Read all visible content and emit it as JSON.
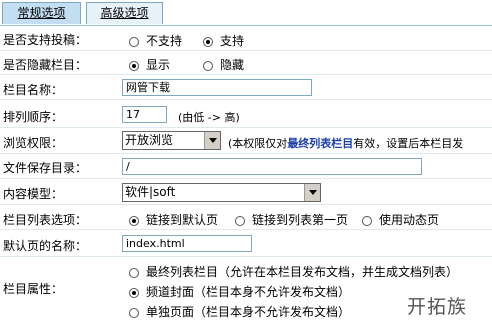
{
  "tabs": {
    "basic": "常规选项",
    "advanced": "高级选项"
  },
  "fields": {
    "allow_submit": {
      "label": "是否支持投稿：",
      "opt_no": "不支持",
      "opt_yes": "支持"
    },
    "hidden": {
      "label": "是否隐藏栏目：",
      "opt_show": "显示",
      "opt_hide": "隐藏"
    },
    "name": {
      "label": "栏目名称：",
      "value": "网管下载"
    },
    "order": {
      "label": "排列顺序：",
      "value": "17",
      "hint": "(由低 -> 高)"
    },
    "permission": {
      "label": "浏览权限：",
      "selected": "开放浏览",
      "note_pre": "(本权限仅对",
      "note_bold": "最终列表栏目",
      "note_post": "有效，设置后本栏目发"
    },
    "save_dir": {
      "label": "文件保存目录：",
      "value": "/"
    },
    "model": {
      "label": "内容模型：",
      "selected": "软件|soft"
    },
    "list_option": {
      "label": "栏目列表选项：",
      "opt1": "链接到默认页",
      "opt2": "链接到列表第一页",
      "opt3": "使用动态页"
    },
    "default_page": {
      "label": "默认页的名称：",
      "value": "index.html"
    },
    "attribute": {
      "label": "栏目属性：",
      "opt1": "最终列表栏目（允许在本栏目发布文档，并生成文档列表）",
      "opt2": "频道封面（栏目本身不允许发布文档）",
      "opt3": "单独页面（栏目本身不允许发布文档）"
    }
  },
  "watermark": "开拓族"
}
